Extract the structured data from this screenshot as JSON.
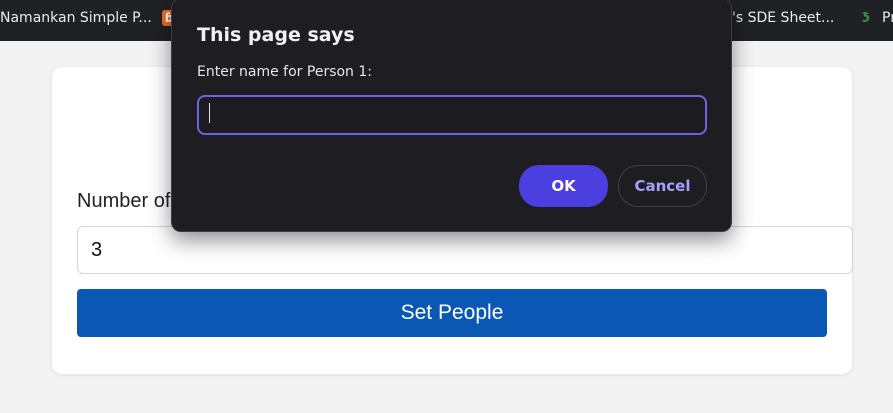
{
  "bookmarks": [
    {
      "label": "Namankan Simple P...",
      "icon": "none"
    },
    {
      "label": "",
      "icon": "orange-square-icon"
    },
    {
      "label": "'s SDE Sheet...",
      "icon": "none"
    },
    {
      "label": "Pr",
      "icon": "gfg-icon"
    }
  ],
  "form": {
    "label": "Number of",
    "value": "3",
    "set_button": "Set People"
  },
  "dialog": {
    "title": "This page says",
    "message": "Enter name for Person 1:",
    "input_value": "",
    "ok": "OK",
    "cancel": "Cancel"
  },
  "colors": {
    "set_button": "#0b58b4",
    "ok_button": "#4c3fe0",
    "cancel_text": "#a7a0ff",
    "dialog_bg": "#1e1e22"
  }
}
